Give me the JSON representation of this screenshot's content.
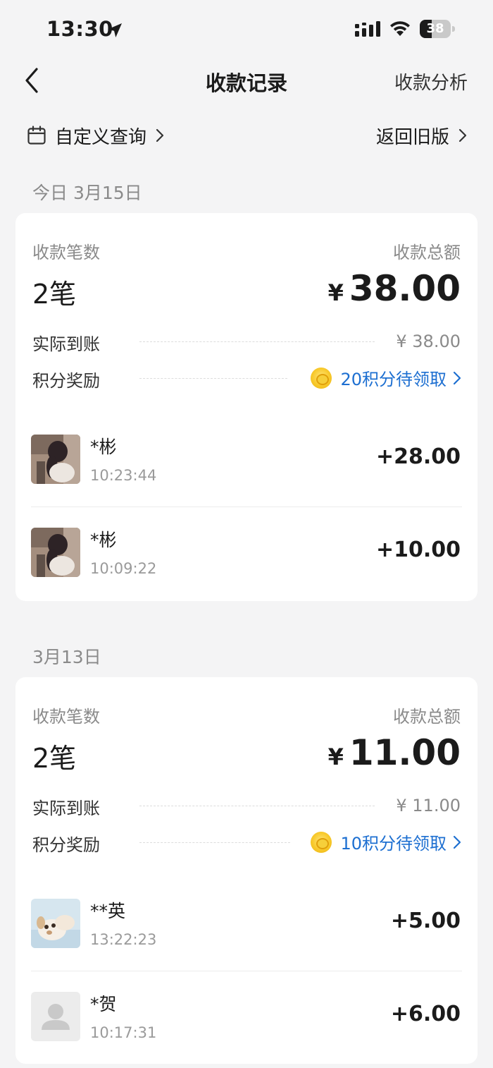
{
  "status_bar": {
    "time": "13:30",
    "battery": "38",
    "battery_level": 0.38
  },
  "nav": {
    "title": "收款记录",
    "analysis": "收款分析"
  },
  "filters": {
    "custom_query": "自定义查询",
    "old_version": "返回旧版"
  },
  "days": [
    {
      "date": "今日 3月15日",
      "count_label": "收款笔数",
      "count": "2笔",
      "total_label": "收款总额",
      "total_currency": "¥",
      "total": "38.00",
      "arrived_label": "实际到账",
      "arrived": "¥ 38.00",
      "points_label": "积分奖励",
      "points": "20积分待领取",
      "transactions": [
        {
          "name": "*彬",
          "time": "10:23:44",
          "amount": "+28.00",
          "avatar": "photo-avatar"
        },
        {
          "name": "*彬",
          "time": "10:09:22",
          "amount": "+10.00",
          "avatar": "photo-avatar"
        }
      ]
    },
    {
      "date": "3月13日",
      "count_label": "收款笔数",
      "count": "2笔",
      "total_label": "收款总额",
      "total_currency": "¥",
      "total": "11.00",
      "arrived_label": "实际到账",
      "arrived": "¥ 11.00",
      "points_label": "积分奖励",
      "points": "10积分待领取",
      "transactions": [
        {
          "name": "**英",
          "time": "13:22:23",
          "amount": "+5.00",
          "avatar": "dog-avatar"
        },
        {
          "name": "*贺",
          "time": "10:17:31",
          "amount": "+6.00",
          "avatar": "default-avatar"
        }
      ]
    }
  ],
  "colors": {
    "accent": "#1d6fd1",
    "background": "#f4f4f5",
    "card": "#ffffff"
  },
  "icons": [
    "location-arrow-icon",
    "cellular-signal-icon",
    "wifi-icon",
    "battery-icon",
    "back-chevron-icon",
    "calendar-icon",
    "chevron-right-icon",
    "coin-icon"
  ]
}
